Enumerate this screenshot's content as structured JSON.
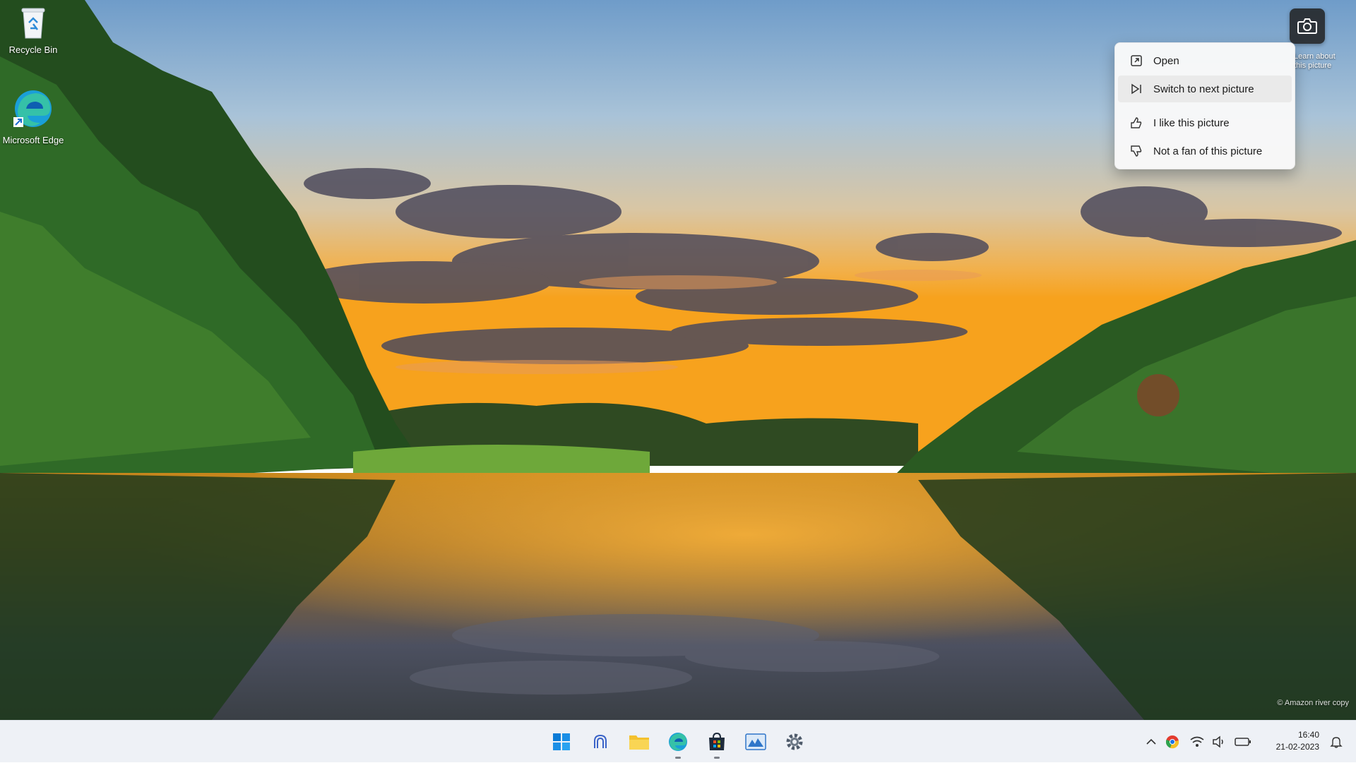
{
  "desktop": {
    "icons": [
      {
        "label": "Recycle Bin"
      },
      {
        "label": "Microsoft Edge"
      }
    ]
  },
  "spotlight": {
    "button_icon": "camera-icon",
    "caption": "Learn about this picture",
    "menu": [
      {
        "label": "Open",
        "icon": "open-icon"
      },
      {
        "label": "Switch to next picture",
        "icon": "next-picture-icon"
      },
      {
        "label": "I like this picture",
        "icon": "thumbs-up-icon"
      },
      {
        "label": "Not a fan of this picture",
        "icon": "thumbs-down-icon"
      }
    ]
  },
  "taskbar": {
    "apps": [
      {
        "name": "Start",
        "icon": "windows-start-icon"
      },
      {
        "name": "Copilot",
        "icon": "copilot-icon"
      },
      {
        "name": "File Explorer",
        "icon": "folder-icon"
      },
      {
        "name": "Microsoft Edge",
        "icon": "edge-icon"
      },
      {
        "name": "Microsoft Store",
        "icon": "store-icon"
      },
      {
        "name": "Photos",
        "icon": "photos-icon"
      },
      {
        "name": "Settings",
        "icon": "settings-icon"
      }
    ],
    "tray": {
      "icons": [
        "chevron-up-icon",
        "chrome-icon",
        "wifi-icon",
        "volume-icon",
        "battery-icon"
      ],
      "time": "16:40",
      "date": "21-02-2023"
    }
  },
  "wallpaper": {
    "copyright": "© Amazon river copy"
  },
  "colors": {
    "taskbar_bg": "#eef1f6",
    "menu_bg": "#f9f9f9",
    "accent_blue": "#0078d4"
  }
}
